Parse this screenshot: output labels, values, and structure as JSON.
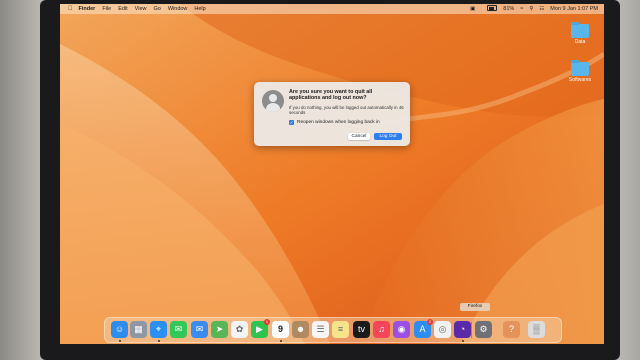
{
  "menubar": {
    "apple_icon": "apple-icon",
    "items": [
      {
        "label": "Finder",
        "bold": true
      },
      {
        "label": "File"
      },
      {
        "label": "Edit"
      },
      {
        "label": "View"
      },
      {
        "label": "Go"
      },
      {
        "label": "Window"
      },
      {
        "label": "Help"
      }
    ],
    "battery_percent": "81%",
    "battery_level": 0.81,
    "clock": "Mon 9 Jan  1:07 PM"
  },
  "desktop_icons": [
    {
      "label": "Data",
      "icon": "folder-icon"
    },
    {
      "label": "Softwares",
      "icon": "folder-icon"
    }
  ],
  "dialog": {
    "title": "Are you sure you want to quit all applications and log out now?",
    "message": "If you do nothing, you will be logged out automatically in 46 seconds",
    "checkbox_label": "Reopen windows when logging back in",
    "checkbox_checked": true,
    "cancel_label": "Cancel",
    "logout_label": "Log Out"
  },
  "tooltip": "Firefox",
  "dock": {
    "items": [
      {
        "name": "finder",
        "icon": "finder-icon",
        "color": "#2e8cf0"
      },
      {
        "name": "launchpad",
        "icon": "launchpad-icon",
        "color": "#8f97a6"
      },
      {
        "name": "safari",
        "icon": "safari-icon",
        "color": "#2a8ff7"
      },
      {
        "name": "messages",
        "icon": "messages-icon",
        "color": "#34c759"
      },
      {
        "name": "mail",
        "icon": "mail-icon",
        "color": "#3b8cf0"
      },
      {
        "name": "maps",
        "icon": "maps-icon",
        "color": "#5ab45a"
      },
      {
        "name": "photos",
        "icon": "photos-icon",
        "color": "#f4f4f4"
      },
      {
        "name": "facetime",
        "icon": "facetime-icon",
        "color": "#2ec44f",
        "badge": "1"
      },
      {
        "name": "calendar",
        "icon": "calendar-icon",
        "color": "#ffffff",
        "text": "9"
      },
      {
        "name": "contacts",
        "icon": "contacts-icon",
        "color": "#b08a62"
      },
      {
        "name": "reminders",
        "icon": "reminders-icon",
        "color": "#f6f6f6"
      },
      {
        "name": "notes",
        "icon": "notes-icon",
        "color": "#f7e48a"
      },
      {
        "name": "apple-tv",
        "icon": "tv-icon",
        "color": "#1b1b1b"
      },
      {
        "name": "music",
        "icon": "music-icon",
        "color": "#f64559"
      },
      {
        "name": "podcasts",
        "icon": "podcasts-icon",
        "color": "#9c4fe0"
      },
      {
        "name": "app-store",
        "icon": "app-store-icon",
        "color": "#2d8cf5",
        "badge": "2"
      },
      {
        "name": "chrome",
        "icon": "chrome-icon",
        "color": "#f2f2f2"
      },
      {
        "name": "firefox",
        "icon": "firefox-icon",
        "color": "#5a2aa8"
      },
      {
        "name": "system-settings",
        "icon": "gear-icon",
        "color": "#6f6f76"
      },
      {
        "name": "help",
        "icon": "question-icon",
        "color": "#e4945a"
      },
      {
        "name": "trash",
        "icon": "trash-icon",
        "color": "#dcdcdc"
      }
    ]
  }
}
